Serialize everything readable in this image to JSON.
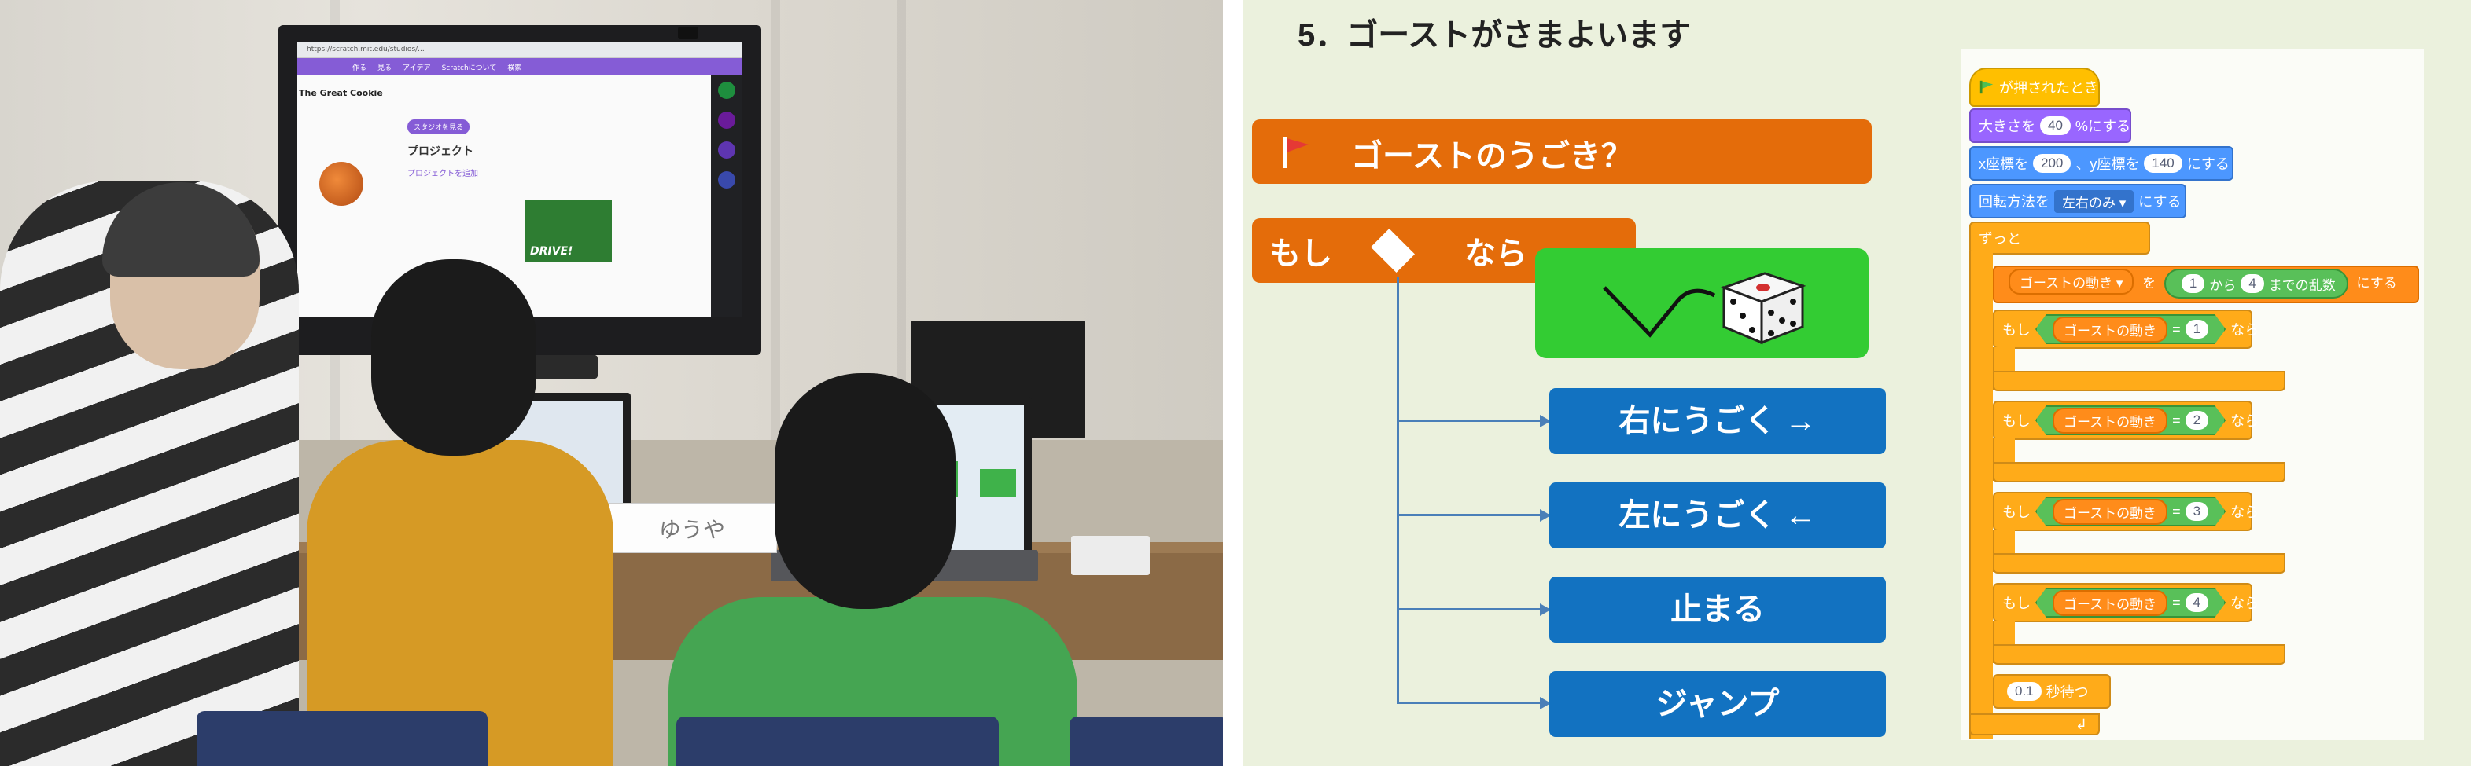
{
  "photo": {
    "tv_screen": {
      "url": "https://scratch.mit.edu/studios/...",
      "nav": [
        "作る",
        "見る",
        "アイデア",
        "Scratchについて",
        "検索"
      ],
      "title": "The Great Cookie",
      "tab": "スタジオを見る",
      "heading": "プロジェクト",
      "subheading": "プロジェクトを追加",
      "project_label": "DRIVE!"
    },
    "name_card": "ゆうや"
  },
  "slide": {
    "title": "5．ゴーストがさまよいます",
    "banner": "ゴーストのうごき？",
    "if_label": "もし",
    "then_label": "なら",
    "options": [
      "右にうごく →",
      "左にうごく ←",
      "止まる",
      "ジャンプ"
    ],
    "scratch": {
      "hat": "が押されたとき",
      "size_pre": "大きさを",
      "size_val": "40",
      "size_post": "%にする",
      "xy_x_label": "x座標を",
      "xy_x": "200",
      "xy_y_label": "、y座標を",
      "xy_y": "140",
      "xy_post": "にする",
      "rot_label": "回転方法を",
      "rot_val": "左右のみ ▾",
      "rot_post": "にする",
      "forever": "ずっと",
      "set_var": "ゴーストの動き ▾",
      "set_to": "を",
      "rand_from": "1",
      "rand_mid": "から",
      "rand_to": "4",
      "rand_post": "までの乱数",
      "set_post": "にする",
      "if_word": "もし",
      "then_word": "なら",
      "cond_var": "ゴーストの動き",
      "eq": "=",
      "cond_vals": [
        "1",
        "2",
        "3",
        "4"
      ],
      "wait_val": "0.1",
      "wait_post": "秒待つ"
    }
  },
  "colors": {
    "slide_bg": "#ebf1dd",
    "orange": "#e46c0a",
    "blue": "#1272c1",
    "green": "#33cc33"
  }
}
